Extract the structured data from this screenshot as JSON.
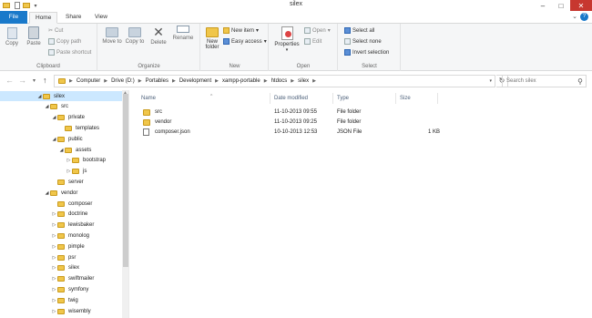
{
  "window": {
    "title": "silex"
  },
  "tabs": {
    "file": "File",
    "home": "Home",
    "share": "Share",
    "view": "View"
  },
  "ribbon": {
    "clipboard": {
      "copy": "Copy",
      "paste": "Paste",
      "cut": "Cut",
      "copy_path": "Copy path",
      "paste_shortcut": "Paste shortcut",
      "label": "Clipboard"
    },
    "organize": {
      "move_to": "Move to",
      "copy_to": "Copy to",
      "delete": "Delete",
      "rename": "Rename",
      "label": "Organize"
    },
    "new": {
      "new_folder": "New folder",
      "new_item": "New item",
      "easy_access": "Easy access",
      "label": "New"
    },
    "open": {
      "properties": "Properties",
      "open": "Open",
      "edit": "Edit",
      "label": "Open"
    },
    "select": {
      "select_all": "Select all",
      "select_none": "Select none",
      "invert_selection": "Invert selection",
      "label": "Select"
    }
  },
  "address": {
    "crumbs": [
      "Computer",
      "Drive (D:)",
      "Portables",
      "Development",
      "xampp-portable",
      "htdocs",
      "silex"
    ],
    "search_placeholder": "Search silex"
  },
  "tree": [
    {
      "label": "silex",
      "depth": 0,
      "expanded": true,
      "selected": true
    },
    {
      "label": "src",
      "depth": 1,
      "expanded": true
    },
    {
      "label": "private",
      "depth": 2,
      "expanded": true
    },
    {
      "label": "templates",
      "depth": 3,
      "expanded": false,
      "leaf": true
    },
    {
      "label": "public",
      "depth": 2,
      "expanded": true
    },
    {
      "label": "assets",
      "depth": 3,
      "expanded": true
    },
    {
      "label": "bootstrap",
      "depth": 4,
      "expanded": false
    },
    {
      "label": "js",
      "depth": 4,
      "expanded": false
    },
    {
      "label": "server",
      "depth": 2,
      "expanded": false,
      "leaf": true
    },
    {
      "label": "vendor",
      "depth": 1,
      "expanded": true
    },
    {
      "label": "composer",
      "depth": 2,
      "expanded": false,
      "leaf": true
    },
    {
      "label": "doctrine",
      "depth": 2,
      "expanded": false
    },
    {
      "label": "lewisbaker",
      "depth": 2,
      "expanded": false
    },
    {
      "label": "monolog",
      "depth": 2,
      "expanded": false
    },
    {
      "label": "pimple",
      "depth": 2,
      "expanded": false
    },
    {
      "label": "psr",
      "depth": 2,
      "expanded": false
    },
    {
      "label": "silex",
      "depth": 2,
      "expanded": false
    },
    {
      "label": "swiftmailer",
      "depth": 2,
      "expanded": false
    },
    {
      "label": "symfony",
      "depth": 2,
      "expanded": false
    },
    {
      "label": "twig",
      "depth": 2,
      "expanded": false
    },
    {
      "label": "wisembly",
      "depth": 2,
      "expanded": false
    }
  ],
  "columns": {
    "name": "Name",
    "date": "Date modified",
    "type": "Type",
    "size": "Size"
  },
  "files": [
    {
      "name": "src",
      "date": "11-10-2013 09:55",
      "type": "File folder",
      "size": "",
      "icon": "folder-icon"
    },
    {
      "name": "vendor",
      "date": "11-10-2013 09:25",
      "type": "File folder",
      "size": "",
      "icon": "folder-icon"
    },
    {
      "name": "composer.json",
      "date": "10-10-2013 12:53",
      "type": "JSON File",
      "size": "1 KB",
      "icon": "json-file-icon"
    }
  ]
}
